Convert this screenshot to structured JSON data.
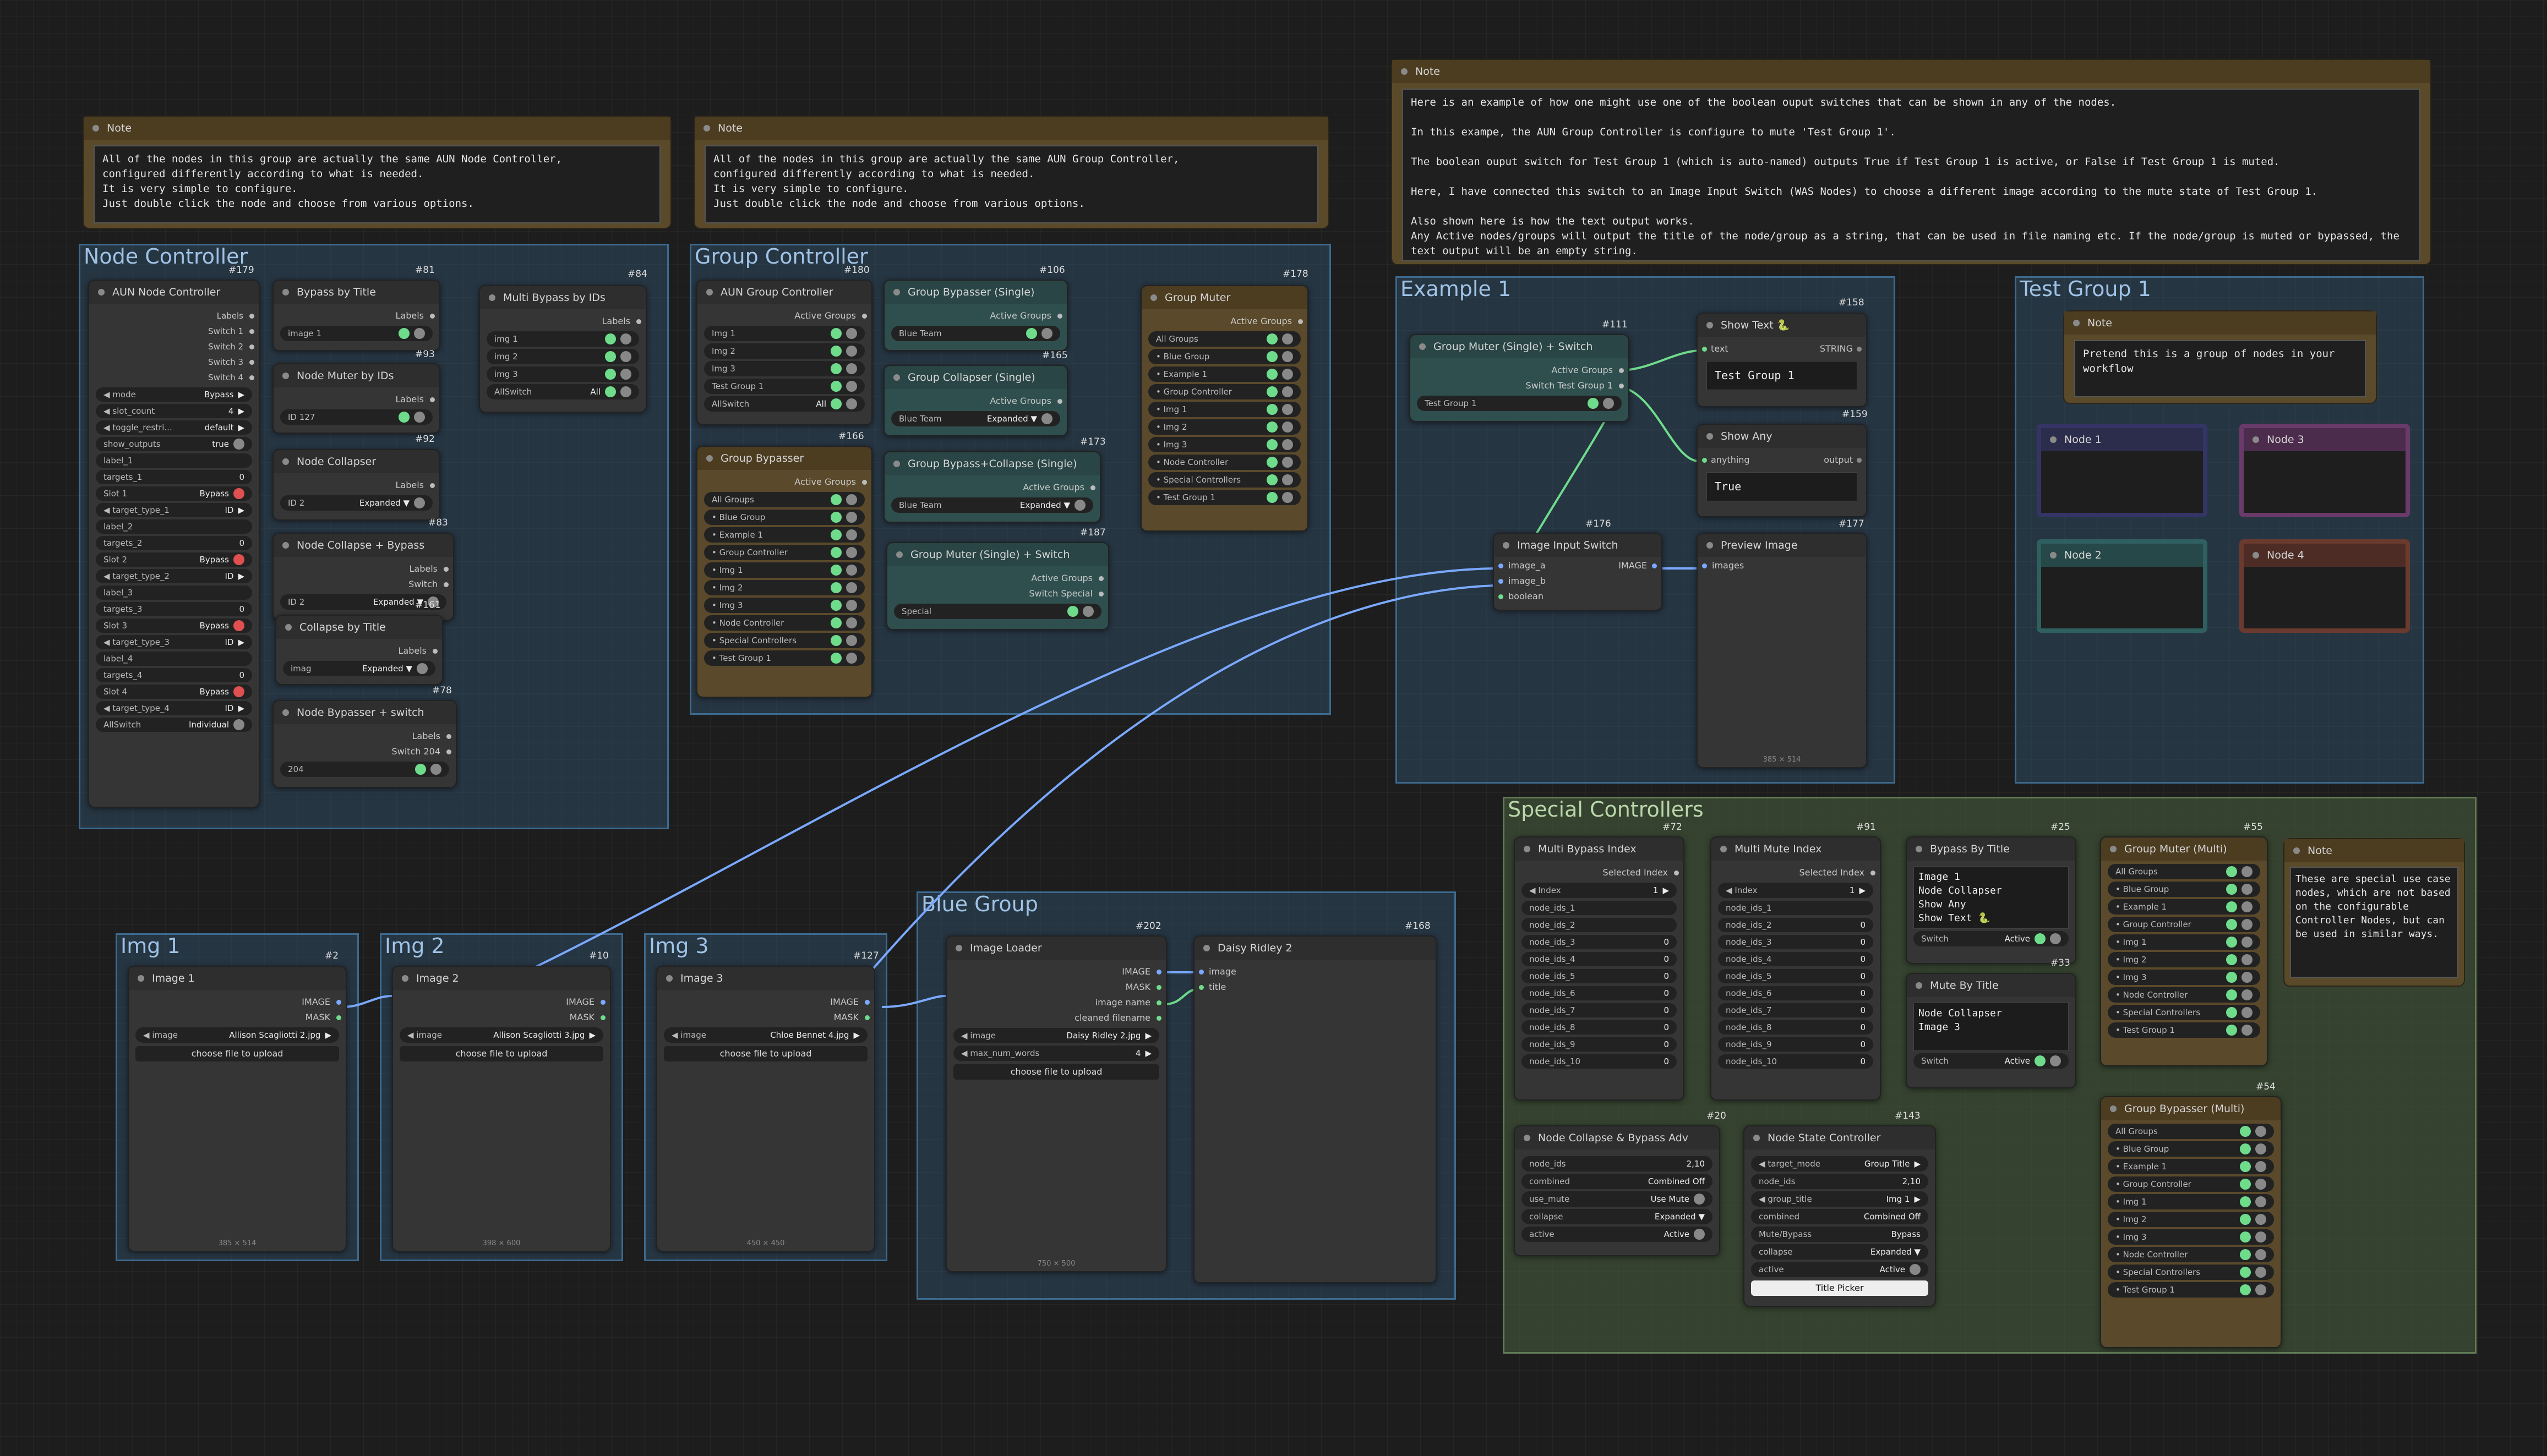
{
  "notes": {
    "note_top_right": {
      "title": "Note",
      "text": "Here is an example of how one might use one of the boolean ouput switches that can be shown in any of the nodes.\n\nIn this exampe, the AUN Group Controller is configure to mute 'Test Group 1'.\n\nThe boolean ouput switch for Test Group 1 (which is auto-named) outputs True if Test Group 1 is active, or False if Test Group 1 is muted.\n\nHere, I have connected this switch to an Image Input Switch (WAS Nodes) to choose a different image according to the mute state of Test Group 1.\n\nAlso shown here is how the text output works.\nAny Active nodes/groups will output the title of the node/group as a string, that can be used in file naming etc. If the node/group is muted or bypassed, the text output will be an empty string."
    },
    "note_node_ctrl": {
      "title": "Note",
      "text": "All of the nodes in this group are actually the same AUN Node Controller,\nconfigured differently according to what is needed.\nIt is very simple to configure.\nJust double click the node and choose from various options."
    },
    "note_group_ctrl": {
      "title": "Note",
      "text": "All of the nodes in this group are actually the same AUN Group Controller,\nconfigured differently according to what is needed.\nIt is very simple to configure.\nJust double click the node and choose from various options."
    },
    "note_test_group": {
      "title": "Note",
      "text": "Pretend this is a group of nodes in your workflow"
    },
    "note_special": {
      "title": "Note",
      "text": "These are special use case nodes, which are not based on the configurable Controller Nodes, but can be used in similar ways."
    }
  },
  "groups": {
    "node_controller": "Node Controller",
    "group_controller": "Group Controller",
    "example1": "Example 1",
    "test_group1": "Test Group 1",
    "special_controllers": "Special Controllers",
    "blue_group": "Blue Group",
    "img1": "Img 1",
    "img2": "Img 2",
    "img3": "Img 3"
  },
  "aun_node_controller": {
    "title": "AUN Node Controller",
    "id": "#179",
    "outputs": [
      "Labels",
      "Switch 1",
      "Switch 2",
      "Switch 3",
      "Switch 4"
    ],
    "widgets": [
      {
        "k": "mode",
        "v": "Bypass",
        "arrow": true
      },
      {
        "k": "slot_count",
        "v": "4",
        "arrow": true
      },
      {
        "k": "toggle_restri...",
        "v": "default",
        "arrow": true
      },
      {
        "k": "show_outputs",
        "v": "true",
        "tog": "gray"
      },
      {
        "k": "label_1",
        "v": ""
      },
      {
        "k": "targets_1",
        "v": "0"
      },
      {
        "k": "Slot 1",
        "v": "Bypass",
        "tog": "red"
      },
      {
        "k": "target_type_1",
        "v": "ID",
        "arrow": true
      },
      {
        "k": "label_2",
        "v": ""
      },
      {
        "k": "targets_2",
        "v": "0"
      },
      {
        "k": "Slot 2",
        "v": "Bypass",
        "tog": "red"
      },
      {
        "k": "target_type_2",
        "v": "ID",
        "arrow": true
      },
      {
        "k": "label_3",
        "v": ""
      },
      {
        "k": "targets_3",
        "v": "0"
      },
      {
        "k": "Slot 3",
        "v": "Bypass",
        "tog": "red"
      },
      {
        "k": "target_type_3",
        "v": "ID",
        "arrow": true
      },
      {
        "k": "label_4",
        "v": ""
      },
      {
        "k": "targets_4",
        "v": "0"
      },
      {
        "k": "Slot 4",
        "v": "Bypass",
        "tog": "red"
      },
      {
        "k": "target_type_4",
        "v": "ID",
        "arrow": true
      },
      {
        "k": "AllSwitch",
        "v": "Individual",
        "tog": "gray"
      }
    ]
  },
  "bypass_by_title": {
    "id": "#81",
    "title": "Bypass by Title",
    "out": "Labels",
    "widget": "image 1"
  },
  "node_muter_ids": {
    "id": "#93",
    "title": "Node Muter by IDs",
    "out": "Labels",
    "widget": "ID 127"
  },
  "node_collapser": {
    "id": "#92",
    "title": "Node Collapser",
    "out": "Labels",
    "widget_k": "ID 2",
    "widget_v": "Expanded ▼"
  },
  "node_collapse_bypass": {
    "id": "#83",
    "title": "Node Collapse + Bypass",
    "out1": "Labels",
    "out2": "Switch",
    "widget_k": "ID 2",
    "widget_v": "Expanded ▼"
  },
  "collapse_by_title": {
    "id": "#161",
    "title": "Collapse by Title",
    "out": "Labels",
    "widget_k": "imag",
    "widget_v": "Expanded ▼"
  },
  "node_bypasser_switch": {
    "id": "#78",
    "title": "Node Bypasser + switch",
    "out1": "Labels",
    "out2": "Switch 204",
    "widget": "204"
  },
  "multi_bypass_ids": {
    "id": "#84",
    "title": "Multi Bypass by IDs",
    "out": "Labels",
    "rows": [
      "img 1",
      "img 2",
      "img 3"
    ],
    "all_k": "AllSwitch",
    "all_v": "All"
  },
  "aun_group_controller": {
    "id": "#180",
    "title": "AUN Group Controller",
    "out": "Active Groups",
    "rows": [
      "Img 1",
      "Img 2",
      "Img 3",
      "Test Group 1"
    ],
    "all_k": "AllSwitch",
    "all_v": "All"
  },
  "group_bypasser_single": {
    "id": "#106",
    "title": "Group Bypasser (Single)",
    "out": "Active Groups",
    "widget": "Blue Team"
  },
  "group_collapser_single": {
    "id": "#165",
    "title": "Group Collapser (Single)",
    "out": "Active Groups",
    "widget_k": "Blue Team",
    "widget_v": "Expanded ▼"
  },
  "group_bypass_collapse": {
    "id": "#173",
    "title": "Group Bypass+Collapse (Single)",
    "out": "Active Groups",
    "widget_k": "Blue Team",
    "widget_v": "Expanded ▼"
  },
  "group_muter_switch": {
    "id": "#187",
    "title": "Group Muter (Single) + Switch",
    "out1": "Active Groups",
    "out2": "Switch Special",
    "widget": "Special"
  },
  "group_bypasser": {
    "id": "#166",
    "title": "Group Bypasser",
    "out": "Active Groups",
    "rows": [
      "All Groups",
      "• Blue Group",
      "• Example 1",
      "• Group Controller",
      "• Img 1",
      "• Img 2",
      "• Img 3",
      "• Node Controller",
      "• Special Controllers",
      "• Test Group 1"
    ]
  },
  "group_muter": {
    "id": "#178",
    "title": "Group Muter",
    "out": "Active Groups",
    "rows": [
      "All Groups",
      "• Blue Group",
      "• Example 1",
      "• Group Controller",
      "• Img 1",
      "• Img 2",
      "• Img 3",
      "• Node Controller",
      "• Special Controllers",
      "• Test Group 1"
    ]
  },
  "example1": {
    "muter": {
      "id": "#111",
      "title": "Group Muter (Single) + Switch",
      "out1": "Active Groups",
      "out2": "Switch Test Group 1",
      "widget": "Test Group 1"
    },
    "show_text": {
      "id": "#158",
      "title": "Show Text 🐍",
      "in": "text",
      "out": "STRING",
      "value": "Test Group 1"
    },
    "show_any": {
      "id": "#159",
      "title": "Show Any",
      "in": "anything",
      "out": "output",
      "value": "True"
    },
    "switch": {
      "id": "#176",
      "title": "Image Input Switch",
      "in": [
        "image_a",
        "image_b",
        "boolean"
      ],
      "out": "IMAGE"
    },
    "preview": {
      "id": "#177",
      "title": "Preview Image",
      "in": "images",
      "dims": "385 × 514"
    }
  },
  "test_group_nodes": [
    "Node 1",
    "Node 3",
    "Node 2",
    "Node 4"
  ],
  "image_nodes": [
    {
      "id": "#2",
      "title": "Image 1",
      "out1": "IMAGE",
      "out2": "MASK",
      "k": "image",
      "file": "Allison Scagliotti 2.jpg",
      "btn": "choose file to upload",
      "dims": "385 × 514"
    },
    {
      "id": "#10",
      "title": "Image 2",
      "out1": "IMAGE",
      "out2": "MASK",
      "k": "image",
      "file": "Allison Scagliotti 3.jpg",
      "btn": "choose file to upload",
      "dims": "398 × 600"
    },
    {
      "id": "#127",
      "title": "Image 3",
      "out1": "IMAGE",
      "out2": "MASK",
      "k": "image",
      "file": "Chloe Bennet 4.jpg",
      "btn": "choose file to upload",
      "dims": "450 × 450"
    }
  ],
  "image_loader": {
    "id": "#202",
    "title": "Image Loader",
    "outs": [
      "IMAGE",
      "MASK",
      "image name",
      "cleaned filename"
    ],
    "k": "image",
    "file": "Daisy Ridley 2.jpg",
    "k2": "max_num_words",
    "v2": "4",
    "btn": "choose file to upload",
    "dims": "750 × 500"
  },
  "daisy": {
    "id": "#168",
    "title": "Daisy Ridley 2",
    "in1": "image",
    "in2": "title"
  },
  "multi_bypass_index": {
    "id": "#72",
    "title": "Multi Bypass Index",
    "out": "Selected Index",
    "index_k": "Index",
    "index_v": "1",
    "rows": [
      [
        "node_ids_1",
        ""
      ],
      [
        "node_ids_2",
        ""
      ],
      [
        "node_ids_3",
        "0"
      ],
      [
        "node_ids_4",
        "0"
      ],
      [
        "node_ids_5",
        "0"
      ],
      [
        "node_ids_6",
        "0"
      ],
      [
        "node_ids_7",
        "0"
      ],
      [
        "node_ids_8",
        "0"
      ],
      [
        "node_ids_9",
        "0"
      ],
      [
        "node_ids_10",
        "0"
      ]
    ]
  },
  "multi_mute_index": {
    "id": "#91",
    "title": "Multi Mute Index",
    "out": "Selected Index",
    "index_k": "Index",
    "index_v": "1",
    "rows": [
      [
        "node_ids_1",
        ""
      ],
      [
        "node_ids_2",
        "0"
      ],
      [
        "node_ids_3",
        "0"
      ],
      [
        "node_ids_4",
        "0"
      ],
      [
        "node_ids_5",
        "0"
      ],
      [
        "node_ids_6",
        "0"
      ],
      [
        "node_ids_7",
        "0"
      ],
      [
        "node_ids_8",
        "0"
      ],
      [
        "node_ids_9",
        "0"
      ],
      [
        "node_ids_10",
        "0"
      ]
    ]
  },
  "bypass_by_title2": {
    "id": "#25",
    "title": "Bypass By Title",
    "text": "Image 1\nNode Collapser\nShow Any\nShow Text 🐍",
    "sw_k": "Switch",
    "sw_v": "Active"
  },
  "mute_by_title": {
    "id": "#33",
    "title": "Mute By Title",
    "text": "Node Collapser\nImage 3",
    "sw_k": "Switch",
    "sw_v": "Active"
  },
  "group_muter_multi": {
    "id": "#55",
    "title": "Group Muter (Multi)",
    "rows": [
      "All Groups",
      "• Blue Group",
      "• Example 1",
      "• Group Controller",
      "• Img 1",
      "• Img 2",
      "• Img 3",
      "• Node Controller",
      "• Special Controllers",
      "• Test Group 1"
    ]
  },
  "group_bypasser_multi": {
    "id": "#54",
    "title": "Group Bypasser (Multi)",
    "rows": [
      "All Groups",
      "• Blue Group",
      "• Example 1",
      "• Group Controller",
      "• Img 1",
      "• Img 2",
      "• Img 3",
      "• Node Controller",
      "• Special Controllers",
      "• Test Group 1"
    ]
  },
  "node_collapse_bypass_adv": {
    "id": "#20",
    "title": "Node Collapse & Bypass Adv",
    "rows": [
      [
        "node_ids",
        "2,10"
      ],
      [
        "combined",
        "Combined Off"
      ],
      [
        "use_mute",
        "Use Mute"
      ],
      [
        "collapse",
        "Expanded ▼"
      ],
      [
        "active",
        "Active"
      ]
    ]
  },
  "node_state_controller": {
    "id": "#143",
    "title": "Node State Controller",
    "rows": [
      [
        "target_mode",
        "Group Title"
      ],
      [
        "node_ids",
        "2,10"
      ],
      [
        "group_title",
        "Img 1"
      ],
      [
        "combined",
        "Combined Off"
      ],
      [
        "Mute/Bypass",
        "Bypass"
      ],
      [
        "collapse",
        "Expanded ▼"
      ],
      [
        "active",
        "Active"
      ]
    ],
    "btn": "Title Picker"
  }
}
